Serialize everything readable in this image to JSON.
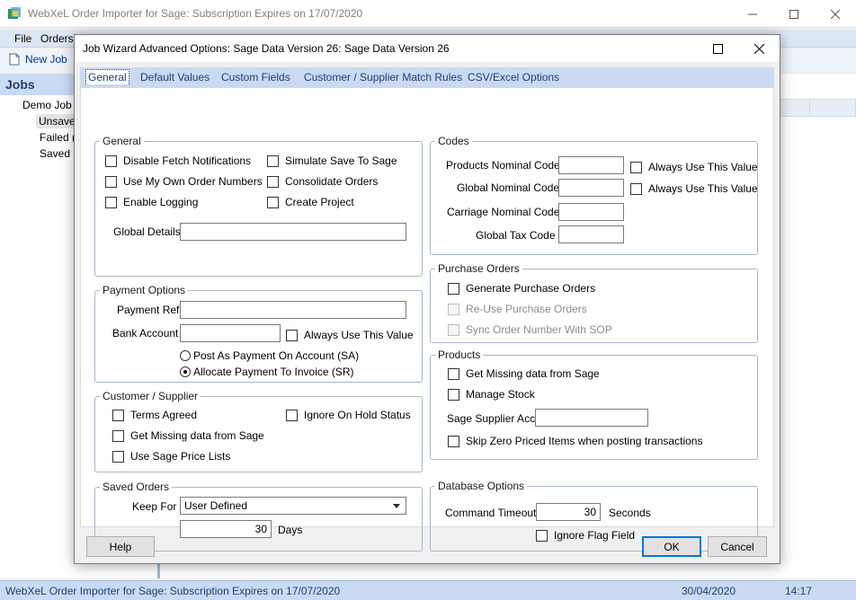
{
  "main_window": {
    "title": "WebXeL Order Importer for Sage: Subscription Expires on 17/07/2020",
    "menu": {
      "file": "File",
      "orders": "Orders"
    },
    "toolbar": {
      "new_job": "New Job"
    },
    "jobs": {
      "header": "Jobs",
      "tree": [
        "Demo Job",
        "Unsave",
        "Failed (",
        "Saved ("
      ]
    },
    "status": {
      "text": "WebXeL Order Importer for Sage: Subscription Expires on 17/07/2020",
      "date": "30/04/2020",
      "time": "14:17"
    }
  },
  "dialog": {
    "title": "Job Wizard Advanced Options: Sage Data Version 26: Sage Data Version 26",
    "tabs": [
      "General",
      "Default Values",
      "Custom Fields",
      "Customer / Supplier Match Rules",
      "CSV/Excel Options"
    ],
    "active_tab": "General",
    "general": {
      "legend": "General",
      "disable_fetch": "Disable Fetch Notifications",
      "own_order_numbers": "Use My Own Order Numbers",
      "enable_logging": "Enable Logging",
      "simulate_save": "Simulate Save To Sage",
      "consolidate_orders": "Consolidate Orders",
      "create_project": "Create Project",
      "global_details_label": "Global Details",
      "global_details_value": ""
    },
    "payment": {
      "legend": "Payment Options",
      "payment_ref_label": "Payment Ref",
      "payment_ref_value": "",
      "bank_account_label": "Bank Account",
      "bank_account_value": "",
      "always_use": "Always Use This Value",
      "post_on_account": "Post As Payment On Account (SA)",
      "allocate_invoice": "Allocate Payment To Invoice (SR)",
      "selected": "allocate_invoice"
    },
    "customer": {
      "legend": "Customer / Supplier",
      "terms_agreed": "Terms Agreed",
      "missing_data": "Get Missing data from Sage",
      "price_lists": "Use Sage Price Lists",
      "ignore_hold": "Ignore On Hold Status"
    },
    "saved_orders": {
      "legend": "Saved Orders",
      "keep_for_label": "Keep For",
      "keep_for_value": "User Defined",
      "days_value": "30",
      "days_label": "Days"
    },
    "codes": {
      "legend": "Codes",
      "products_nominal": "Products Nominal Code",
      "global_nominal": "Global Nominal Code",
      "carriage_nominal": "Carriage Nominal Code",
      "global_tax": "Global Tax Code",
      "always_use": "Always Use This Value"
    },
    "purchase_orders": {
      "legend": "Purchase Orders",
      "generate": "Generate Purchase Orders",
      "reuse": "Re-Use Purchase Orders",
      "sync_number": "Sync Order Number With SOP"
    },
    "products": {
      "legend": "Products",
      "missing_data": "Get Missing data from Sage",
      "manage_stock": "Manage Stock",
      "supplier_acc_label": "Sage Supplier Acc",
      "supplier_acc_value": "",
      "skip_zero": "Skip Zero Priced Items when posting transactions"
    },
    "database": {
      "legend": "Database Options",
      "timeout_label": "Command Timeout",
      "timeout_value": "30",
      "seconds_label": "Seconds",
      "ignore_flag": "Ignore Flag Field"
    },
    "buttons": {
      "help": "Help",
      "ok": "OK",
      "cancel": "Cancel"
    }
  },
  "colors": {
    "accent": "#c9daf2",
    "focus": "#0078d7",
    "legend_border": "#a8b6cc"
  }
}
